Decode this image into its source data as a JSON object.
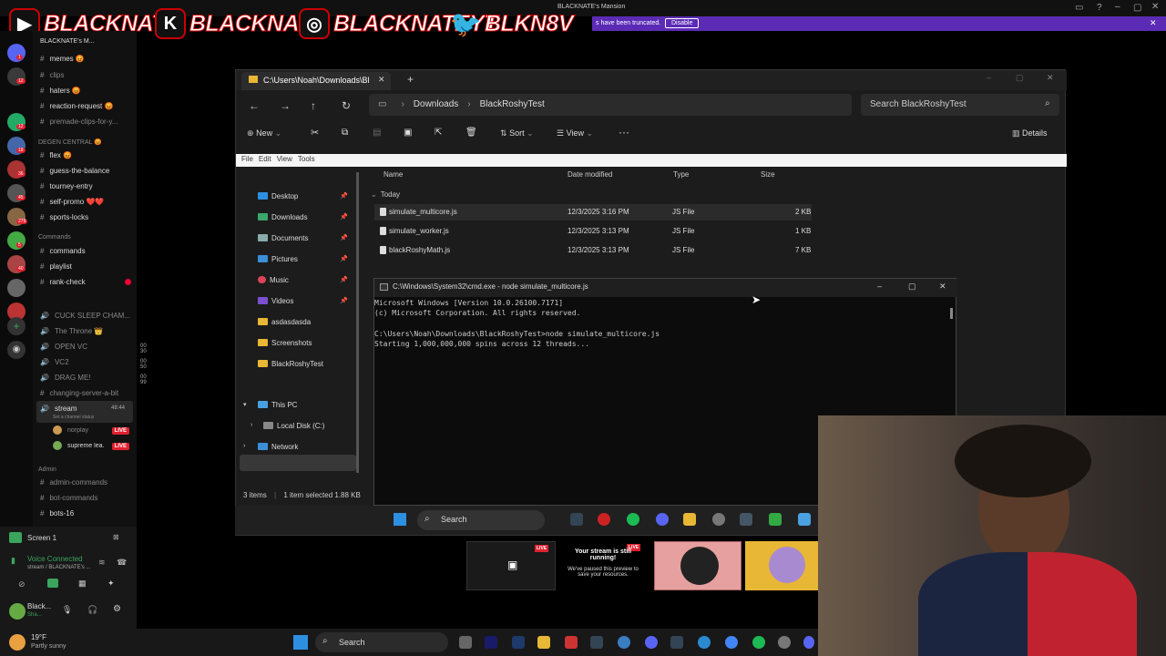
{
  "topbar": {
    "title": "BLACKNATE's Mansion"
  },
  "notice": {
    "text": "s have been truncated.",
    "button": "Disable"
  },
  "social": {
    "youtube": "BLACKNATE",
    "kick": "BLACKNATE",
    "instagram": "BLACKNATEYT",
    "twitter": "BLKN8V"
  },
  "server_badges": [
    "1",
    "12",
    "12",
    "18",
    "36",
    "45",
    "279",
    "5",
    "40"
  ],
  "channels": [
    {
      "label": "BLACKNATE's M..."
    },
    {
      "label": "memes 😡"
    },
    {
      "label": "clips"
    },
    {
      "label": "haters 😡"
    },
    {
      "label": "reaction-request 😡"
    },
    {
      "label": "premade-clips-for-y..."
    },
    {
      "label": "DEGEN CENTRAL 😡"
    },
    {
      "label": "flex 😡"
    },
    {
      "label": "guess-the-balance"
    },
    {
      "label": "tourney-entry"
    },
    {
      "label": "self-promo ❤️❤️"
    },
    {
      "label": "sports-locks"
    },
    {
      "label": "Commands"
    },
    {
      "label": "commands"
    },
    {
      "label": "playlist"
    },
    {
      "label": "rank-check"
    },
    {
      "label": "CUCK SLEEP CHAM..."
    },
    {
      "label": "The Throne 👑"
    },
    {
      "label": "OPEN VC"
    },
    {
      "label": "VC2"
    },
    {
      "label": "DRAG ME!"
    },
    {
      "label": "changing-server-a-bit"
    },
    {
      "label": "stream"
    },
    {
      "label": "Set a channel status"
    },
    {
      "label": "norplay"
    },
    {
      "label": "supreme lea..."
    },
    {
      "label": "Admin"
    },
    {
      "label": "admin-commands"
    },
    {
      "label": "bot-commands"
    },
    {
      "label": "bots-16"
    }
  ],
  "voice_counts": {
    "open": "00 30",
    "vc2": "00 50",
    "drag": "00 99",
    "stream_time": "48:44"
  },
  "live_label": "LIVE",
  "discord_bottom": {
    "screen": "Screen 1",
    "voice": "Voice Connected",
    "voice_sub": "stream / BLACKNATE's ...",
    "user": "Black...",
    "user_sub": "Sha..."
  },
  "weather": {
    "temp": "19°F",
    "desc": "Partly sunny"
  },
  "explorer": {
    "tab_title": "C:\\Users\\Noah\\Downloads\\Bl",
    "breadcrumb": [
      "Downloads",
      "BlackRoshyTest"
    ],
    "search_placeholder": "Search BlackRoshyTest",
    "toolbar": {
      "new": "New",
      "sort": "Sort",
      "view": "View",
      "details": "Details"
    },
    "menu": [
      "File",
      "Edit",
      "View",
      "Tools"
    ],
    "nav": [
      "Desktop",
      "Downloads",
      "Documents",
      "Pictures",
      "Music",
      "Videos",
      "asdasdasda",
      "Screenshots",
      "BlackRoshyTest",
      "This PC",
      "Local Disk (C:)",
      "Network"
    ],
    "columns": [
      "Name",
      "Date modified",
      "Type",
      "Size"
    ],
    "group": "Today",
    "files": [
      {
        "name": "simulate_multicore.js",
        "date": "12/3/2025 3:16 PM",
        "type": "JS File",
        "size": "2 KB"
      },
      {
        "name": "simulate_worker.js",
        "date": "12/3/2025 3:13 PM",
        "type": "JS File",
        "size": "1 KB"
      },
      {
        "name": "blackRoshyMath.js",
        "date": "12/3/2025 3:13 PM",
        "type": "JS File",
        "size": "7 KB"
      }
    ],
    "status": {
      "count": "3 items",
      "selected": "1 item selected  1.88 KB"
    }
  },
  "cmd": {
    "title": "C:\\Windows\\System32\\cmd.exe - node  simulate_multicore.js",
    "lines": [
      "Microsoft Windows [Version 10.0.26100.7171]",
      "(c) Microsoft Corporation. All rights reserved.",
      "",
      "C:\\Users\\Noah\\Downloads\\BlackRoshyTest>node simulate_multicore.js",
      "Starting 1,000,000,000 spins across 12 threads..."
    ]
  },
  "inner_taskbar": {
    "search": "Search"
  },
  "stream_preview": {
    "live": "LIVE",
    "msg_title": "Your stream is still running!",
    "msg_body": "We've paused this preview to save your resources."
  },
  "taskbar": {
    "search": "Search"
  },
  "colors": {
    "accent": "#5b2bb5",
    "live": "#e0202f",
    "folder": "#e8b735"
  }
}
